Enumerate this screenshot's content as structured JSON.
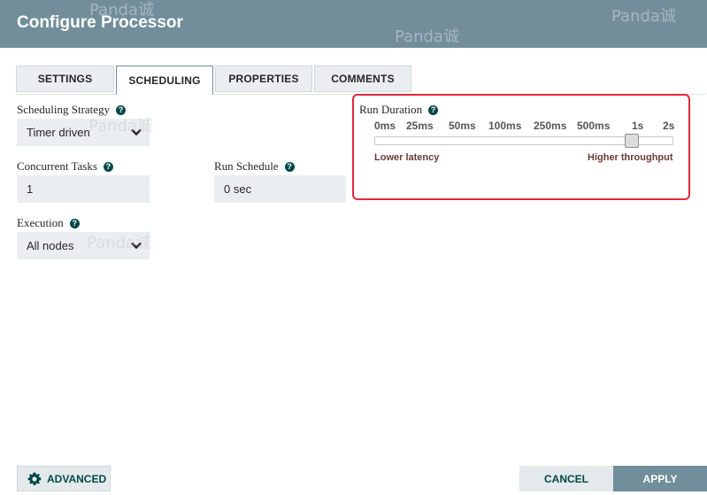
{
  "dialog": {
    "title": "Configure Processor"
  },
  "watermark": {
    "text": "Panda诚"
  },
  "tabs": [
    {
      "label": "SETTINGS",
      "active": false
    },
    {
      "label": "SCHEDULING",
      "active": true
    },
    {
      "label": "PROPERTIES",
      "active": false
    },
    {
      "label": "COMMENTS",
      "active": false
    }
  ],
  "scheduling": {
    "strategy": {
      "label": "Scheduling Strategy",
      "value": "Timer driven"
    },
    "concurrent_tasks": {
      "label": "Concurrent Tasks",
      "value": "1"
    },
    "run_schedule": {
      "label": "Run Schedule",
      "value": "0 sec"
    },
    "execution": {
      "label": "Execution",
      "value": "All nodes"
    }
  },
  "run_duration": {
    "label": "Run Duration",
    "ticks": [
      "0ms",
      "25ms",
      "50ms",
      "100ms",
      "250ms",
      "500ms",
      "1s",
      "2s"
    ],
    "selected_index": 6,
    "low_label": "Lower latency",
    "high_label": "Higher throughput",
    "highlight_color": "#e3283d"
  },
  "footer": {
    "advanced_label": "ADVANCED",
    "cancel_label": "CANCEL",
    "apply_label": "APPLY"
  },
  "colors": {
    "header": "#728e9b",
    "accent": "#004849"
  }
}
